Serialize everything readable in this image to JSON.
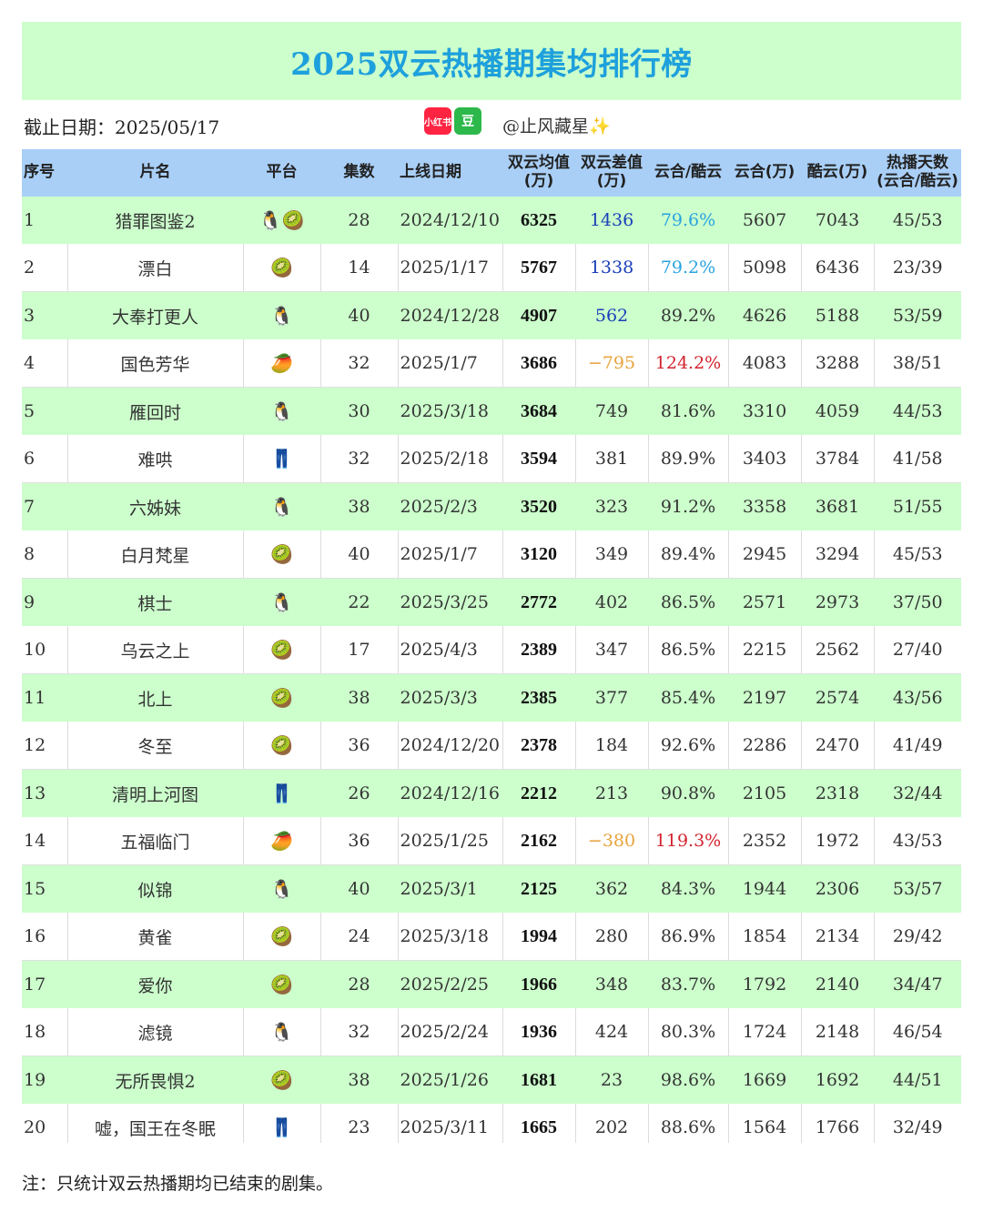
{
  "title": "2025双云热播期集均排行榜",
  "cutoff": "截止日期：2025/05/17",
  "badges": {
    "xhs": "小红书",
    "douban": "豆"
  },
  "handle": "@止风藏星",
  "sparkle": "✨",
  "headers": {
    "rank": "序号",
    "name": "片名",
    "platform": "平台",
    "episodes": "集数",
    "date": "上线日期",
    "avg": "双云均值\n(万)",
    "diff": "双云差值\n(万)",
    "ratio": "云合/酷云",
    "yunhe": "云合(万)",
    "kuyun": "酷云(万)",
    "days": "热播天数\n(云合/酷云)"
  },
  "platform_icons": {
    "tencent": "🐧",
    "iqiyi": "🥝",
    "mango": "🥭",
    "youku": "👖"
  },
  "rows": [
    {
      "rank": "1",
      "name": "猎罪图鉴2",
      "platform": "🐧🥝",
      "episodes": "28",
      "date": "2024/12/10",
      "avg": "6325",
      "diff": "1436",
      "ratio": "79.6%",
      "yunhe": "5607",
      "kuyun": "7043",
      "days": "45/53"
    },
    {
      "rank": "2",
      "name": "漂白",
      "platform": "🥝",
      "episodes": "14",
      "date": "2025/1/17",
      "avg": "5767",
      "diff": "1338",
      "ratio": "79.2%",
      "yunhe": "5098",
      "kuyun": "6436",
      "days": "23/39"
    },
    {
      "rank": "3",
      "name": "大奉打更人",
      "platform": "🐧",
      "episodes": "40",
      "date": "2024/12/28",
      "avg": "4907",
      "diff": "562",
      "ratio": "89.2%",
      "yunhe": "4626",
      "kuyun": "5188",
      "days": "53/59"
    },
    {
      "rank": "4",
      "name": "国色芳华",
      "platform": "🥭",
      "episodes": "32",
      "date": "2025/1/7",
      "avg": "3686",
      "diff": "−795",
      "ratio": "124.2%",
      "yunhe": "4083",
      "kuyun": "3288",
      "days": "38/51"
    },
    {
      "rank": "5",
      "name": "雁回时",
      "platform": "🐧",
      "episodes": "30",
      "date": "2025/3/18",
      "avg": "3684",
      "diff": "749",
      "ratio": "81.6%",
      "yunhe": "3310",
      "kuyun": "4059",
      "days": "44/53"
    },
    {
      "rank": "6",
      "name": "难哄",
      "platform": "👖",
      "episodes": "32",
      "date": "2025/2/18",
      "avg": "3594",
      "diff": "381",
      "ratio": "89.9%",
      "yunhe": "3403",
      "kuyun": "3784",
      "days": "41/58"
    },
    {
      "rank": "7",
      "name": "六姊妹",
      "platform": "🐧",
      "episodes": "38",
      "date": "2025/2/3",
      "avg": "3520",
      "diff": "323",
      "ratio": "91.2%",
      "yunhe": "3358",
      "kuyun": "3681",
      "days": "51/55"
    },
    {
      "rank": "8",
      "name": "白月梵星",
      "platform": "🥝",
      "episodes": "40",
      "date": "2025/1/7",
      "avg": "3120",
      "diff": "349",
      "ratio": "89.4%",
      "yunhe": "2945",
      "kuyun": "3294",
      "days": "45/53"
    },
    {
      "rank": "9",
      "name": "棋士",
      "platform": "🐧",
      "episodes": "22",
      "date": "2025/3/25",
      "avg": "2772",
      "diff": "402",
      "ratio": "86.5%",
      "yunhe": "2571",
      "kuyun": "2973",
      "days": "37/50"
    },
    {
      "rank": "10",
      "name": "乌云之上",
      "platform": "🥝",
      "episodes": "17",
      "date": "2025/4/3",
      "avg": "2389",
      "diff": "347",
      "ratio": "86.5%",
      "yunhe": "2215",
      "kuyun": "2562",
      "days": "27/40"
    },
    {
      "rank": "11",
      "name": "北上",
      "platform": "🥝",
      "episodes": "38",
      "date": "2025/3/3",
      "avg": "2385",
      "diff": "377",
      "ratio": "85.4%",
      "yunhe": "2197",
      "kuyun": "2574",
      "days": "43/56"
    },
    {
      "rank": "12",
      "name": "冬至",
      "platform": "🥝",
      "episodes": "36",
      "date": "2024/12/20",
      "avg": "2378",
      "diff": "184",
      "ratio": "92.6%",
      "yunhe": "2286",
      "kuyun": "2470",
      "days": "41/49"
    },
    {
      "rank": "13",
      "name": "清明上河图",
      "platform": "👖",
      "episodes": "26",
      "date": "2024/12/16",
      "avg": "2212",
      "diff": "213",
      "ratio": "90.8%",
      "yunhe": "2105",
      "kuyun": "2318",
      "days": "32/44"
    },
    {
      "rank": "14",
      "name": "五福临门",
      "platform": "🥭",
      "episodes": "36",
      "date": "2025/1/25",
      "avg": "2162",
      "diff": "−380",
      "ratio": "119.3%",
      "yunhe": "2352",
      "kuyun": "1972",
      "days": "43/53"
    },
    {
      "rank": "15",
      "name": "似锦",
      "platform": "🐧",
      "episodes": "40",
      "date": "2025/3/1",
      "avg": "2125",
      "diff": "362",
      "ratio": "84.3%",
      "yunhe": "1944",
      "kuyun": "2306",
      "days": "53/57"
    },
    {
      "rank": "16",
      "name": "黄雀",
      "platform": "🥝",
      "episodes": "24",
      "date": "2025/3/18",
      "avg": "1994",
      "diff": "280",
      "ratio": "86.9%",
      "yunhe": "1854",
      "kuyun": "2134",
      "days": "29/42"
    },
    {
      "rank": "17",
      "name": "爱你",
      "platform": "🥝",
      "episodes": "28",
      "date": "2025/2/25",
      "avg": "1966",
      "diff": "348",
      "ratio": "83.7%",
      "yunhe": "1792",
      "kuyun": "2140",
      "days": "34/47"
    },
    {
      "rank": "18",
      "name": "滤镜",
      "platform": "🐧",
      "episodes": "32",
      "date": "2025/2/24",
      "avg": "1936",
      "diff": "424",
      "ratio": "80.3%",
      "yunhe": "1724",
      "kuyun": "2148",
      "days": "46/54"
    },
    {
      "rank": "19",
      "name": "无所畏惧2",
      "platform": "🥝",
      "episodes": "38",
      "date": "2025/1/26",
      "avg": "1681",
      "diff": "23",
      "ratio": "98.6%",
      "yunhe": "1669",
      "kuyun": "1692",
      "days": "44/51"
    },
    {
      "rank": "20",
      "name": "嘘，国王在冬眠",
      "platform": "👖",
      "episodes": "23",
      "date": "2025/3/11",
      "avg": "1665",
      "diff": "202",
      "ratio": "88.6%",
      "yunhe": "1564",
      "kuyun": "1766",
      "days": "32/49"
    }
  ],
  "note": "注：只统计双云热播期均已结束的剧集。",
  "colors": {
    "title": "#1ea0dc",
    "header_bg": "#a9cff7",
    "band_green": "#ccffcc",
    "diff_blue": "#1a3fb8",
    "diff_orange": "#e8a33c",
    "ratio_blue": "#29a3e0",
    "ratio_red": "#d3232f"
  }
}
